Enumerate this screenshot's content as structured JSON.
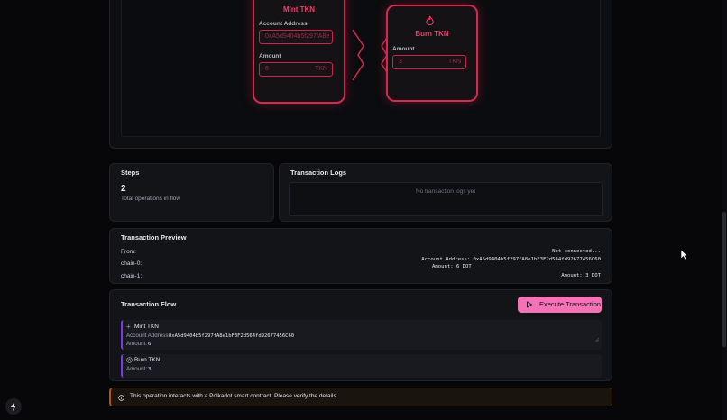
{
  "flow_canvas": {
    "mint_node": {
      "title": "Mint TKN",
      "account_label": "Account Address",
      "account_value": "0xA5d9404b5f297fA8e",
      "amount_label": "Amount",
      "amount_value": "6",
      "amount_unit": "TKN",
      "icon": "plus-icon"
    },
    "burn_node": {
      "title": "Burn TKN",
      "amount_label": "Amount",
      "amount_value": "3",
      "amount_unit": "TKN",
      "icon": "flame-icon"
    }
  },
  "steps": {
    "title": "Steps",
    "count": "2",
    "caption": "Total operations in flow"
  },
  "transaction_logs": {
    "title": "Transaction Logs",
    "empty_text": "No transaction logs yet"
  },
  "preview": {
    "title": "Transaction Preview",
    "rows": [
      {
        "label": "From:",
        "value": "Not connected..."
      },
      {
        "label": "chain-0:",
        "value": "Account Address: 0xA5d9404b5f297fA8e1bF3F2d564fd92677456C60",
        "value2": "Amount: 6 DOT"
      },
      {
        "label": "chain-1:",
        "value": "Amount: 3 DOT"
      }
    ]
  },
  "flow": {
    "title": "Transaction Flow",
    "execute_label": "Execute Transaction",
    "items": [
      {
        "title": "Mint TKN",
        "icon": "plus-icon",
        "account_label": "Account Address:",
        "account_value": "0xA5d9404b5f297fA8e1bF3F2d564fd92677456C60",
        "amount_label": "Amount:",
        "amount_value": "6"
      },
      {
        "title": "Burn TKN",
        "icon": "flame-icon",
        "amount_label": "Amount:",
        "amount_value": "3"
      }
    ]
  },
  "warning": {
    "text": "This operation interacts with a Polkadot smart contract. Please verify the details.",
    "icon": "info-icon"
  },
  "colors": {
    "accent": "#ef3f66",
    "execute_button": "#f472b6",
    "step_border": "#7c3aed",
    "warning_border": "#b45309"
  }
}
